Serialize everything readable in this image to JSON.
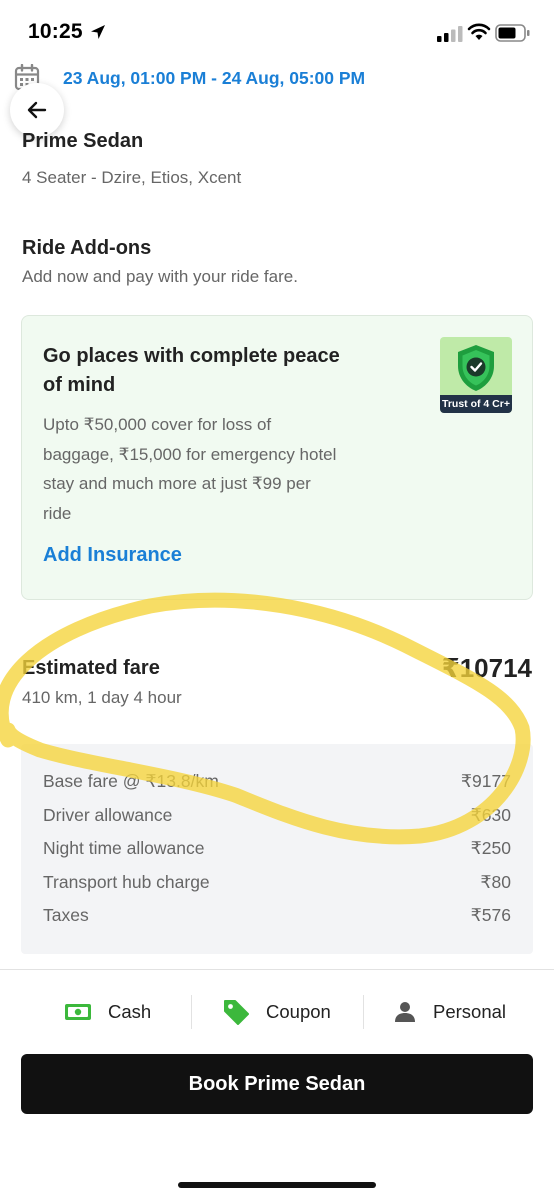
{
  "status_bar": {
    "time": "10:25",
    "icons": [
      "location-arrow-icon",
      "cellular-signal-icon",
      "wifi-icon",
      "battery-icon"
    ]
  },
  "booking": {
    "date_range": "23 Aug, 01:00 PM - 24 Aug, 05:00 PM",
    "date_icon": "calendar-icon",
    "back_icon": "arrow-left-icon"
  },
  "car": {
    "name": "Prime Sedan",
    "description": "4 Seater - Dzire, Etios, Xcent"
  },
  "addons": {
    "title": "Ride Add-ons",
    "subtitle": "Add now and pay with your ride fare."
  },
  "insurance": {
    "title": "Go places with complete peace of mind",
    "body": "Upto ₹50,000 cover for loss of baggage, ₹15,000 for emergency hotel stay and much more at just ₹99 per ride",
    "link": "Add Insurance",
    "badge": "Trust of 4 Cr+",
    "icon": "shield-check-icon"
  },
  "fare": {
    "title": "Estimated fare",
    "subtitle": "410 km, 1 day 4 hour",
    "total": "₹10714",
    "breakdown": [
      {
        "label": "Base fare @ ₹13.8/km",
        "value": "₹9177"
      },
      {
        "label": "Driver allowance",
        "value": "₹630"
      },
      {
        "label": "Night time allowance",
        "value": "₹250"
      },
      {
        "label": "Transport hub charge",
        "value": "₹80"
      },
      {
        "label": "Taxes",
        "value": "₹576"
      }
    ]
  },
  "payment": {
    "cash": "Cash",
    "coupon": "Coupon",
    "profile": "Personal"
  },
  "book_button": "Book Prime Sedan",
  "colors": {
    "accent": "#1a7fd6",
    "cash_icon": "#3cb83c",
    "card_bg": "#f1faf1",
    "highlight": "#f5d33a"
  }
}
